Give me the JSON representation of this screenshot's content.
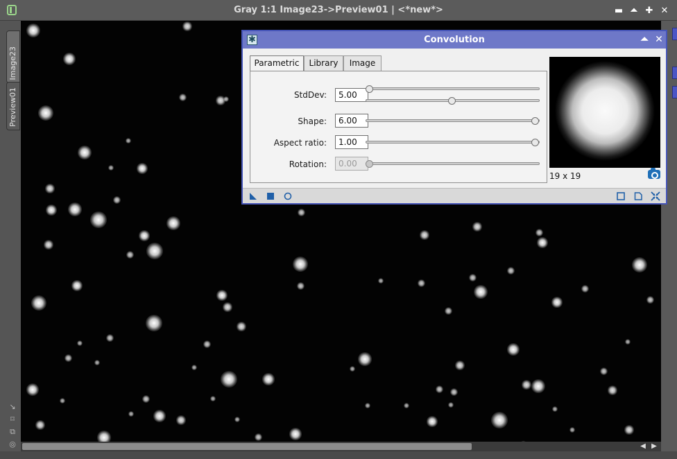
{
  "image_window": {
    "title": "Gray 1:1 Image23->Preview01 | <*new*>",
    "controls": [
      "minimize-icon",
      "shade-icon",
      "maximize-icon",
      "close-icon"
    ],
    "tabs": [
      {
        "label": "Image23",
        "active": true
      },
      {
        "label": "Preview01",
        "active": false
      }
    ],
    "left_tools": [
      "cursor-icon",
      "fit-view-icon",
      "duplicate-icon",
      "target-icon"
    ],
    "background_color": "#030303"
  },
  "dialog": {
    "title": "Convolution",
    "accent_color": "#6e78c8",
    "tabs": [
      {
        "label": "Parametric",
        "active": true
      },
      {
        "label": "Library",
        "active": false
      },
      {
        "label": "Image",
        "active": false
      }
    ],
    "params": {
      "stddev": {
        "label": "StdDev:",
        "value": "5.00",
        "slider_fine": 0.0,
        "slider_coarse": 0.5
      },
      "shape": {
        "label": "Shape:",
        "value": "6.00",
        "slider": 1.0
      },
      "aspect": {
        "label": "Aspect ratio:",
        "value": "1.00",
        "slider": 1.0
      },
      "rotation": {
        "label": "Rotation:",
        "value": "0.00",
        "slider": 0.0,
        "disabled": true
      }
    },
    "kernel_size": "19 x 19",
    "bottom_icons": [
      "new-instance-icon",
      "apply-global-icon",
      "reset-icon",
      "preview-icon",
      "document-icon",
      "collapse-icon"
    ]
  }
}
